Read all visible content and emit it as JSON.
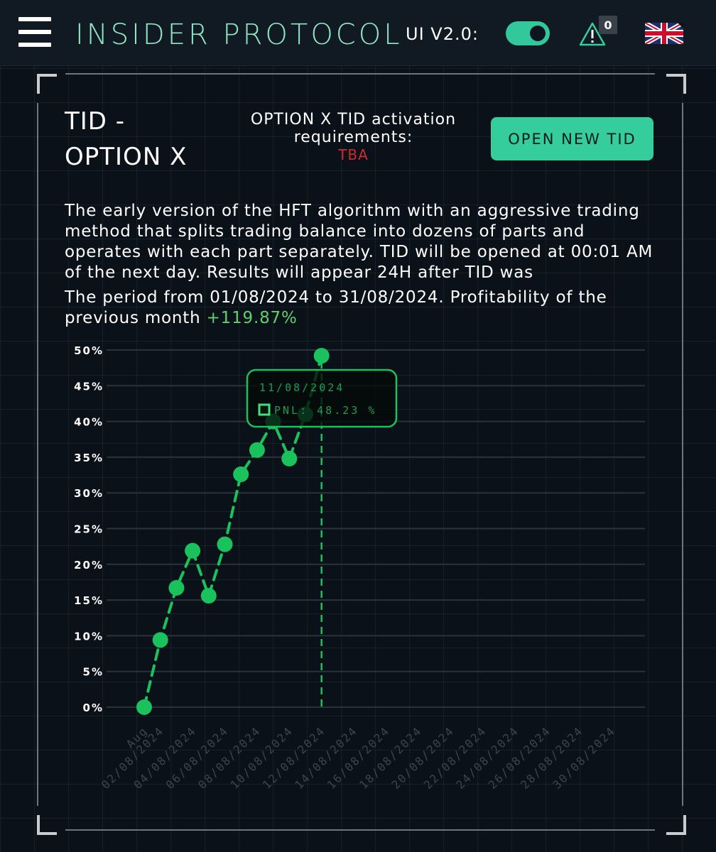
{
  "header": {
    "brand": "INSIDER PROTOCOL",
    "ui_version_label": "UI V2.0:",
    "ui_toggle_on": true,
    "alert_count": "0",
    "language_flag": "uk-flag-icon",
    "accent": "#35cd9c"
  },
  "card": {
    "title_line1": "TID -",
    "title_line2": "OPTION X",
    "requirements_line1": "OPTION X TID activation",
    "requirements_line2": "requirements:",
    "requirements_value": "TBA",
    "open_button": "OPEN NEW TID",
    "description": "The early version of the HFT algorithm with an aggressive trading method that splits trading balance into dozens of parts and operates with each part separately. TID will be opened at 00:01 AM of the next day. Results will appear 24H after TID was",
    "period_text": "The period from 01/08/2024 to 31/08/2024. Profitability of the previous month ",
    "profitability": "+119.87%"
  },
  "chart_data": {
    "type": "line",
    "y_ticks": [
      "50%",
      "45%",
      "40%",
      "35%",
      "30%",
      "25%",
      "20%",
      "15%",
      "10%",
      "5%",
      "0%"
    ],
    "x_ticks": [
      "Aug",
      "02/08/2024",
      "04/08/2024",
      "06/08/2024",
      "08/08/2024",
      "10/08/2024",
      "12/08/2024",
      "14/08/2024",
      "16/08/2024",
      "18/08/2024",
      "20/08/2024",
      "22/08/2024",
      "24/08/2024",
      "26/08/2024",
      "28/08/2024",
      "30/08/2024"
    ],
    "ylim": [
      0,
      50
    ],
    "x": [
      1,
      2,
      3,
      4,
      5,
      6,
      7,
      8,
      9,
      10,
      11,
      12
    ],
    "series": [
      {
        "values": [
          0,
          9.4,
          16.7,
          21.9,
          15.6,
          22.8,
          32.6,
          36.0,
          40.0,
          34.8,
          41.0,
          49.2
        ]
      }
    ],
    "line_color": "#19c25c",
    "tooltip": {
      "date": "11/08/2024",
      "label": "PNL:",
      "value": "48.23 %"
    },
    "grid": true
  }
}
